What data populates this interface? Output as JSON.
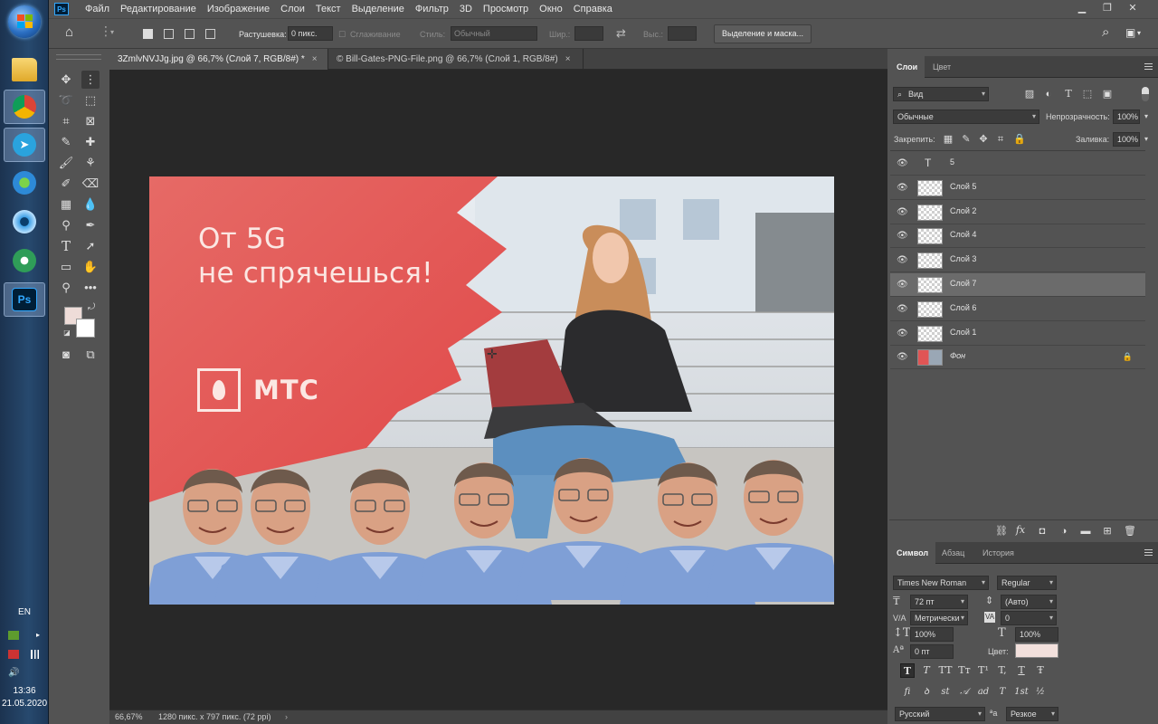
{
  "taskbar": {
    "language": "EN",
    "time": "13:36",
    "date": "21.05.2020"
  },
  "menu": {
    "app_logo": "Ps",
    "items": [
      "Файл",
      "Редактирование",
      "Изображение",
      "Слои",
      "Текст",
      "Выделение",
      "Фильтр",
      "3D",
      "Просмотр",
      "Окно",
      "Справка"
    ]
  },
  "options": {
    "feather_label": "Растушевка:",
    "feather_value": "0 пикс.",
    "antialias_label": "Сглаживание",
    "style_label": "Стиль:",
    "style_value": "Обычный",
    "width_label": "Шир.:",
    "height_label": "Выс.:",
    "select_mask_button": "Выделение и маска..."
  },
  "documents": {
    "tabs": [
      {
        "title": "3ZmlvNVJJg.jpg @ 66,7% (Слой 7, RGB/8#) *",
        "close": "×"
      },
      {
        "title": "© Bill-Gates-PNG-File.png @ 66,7% (Слой 1, RGB/8#)",
        "close": "×"
      }
    ]
  },
  "artwork": {
    "headline_line1": "От 5G",
    "headline_line2": "не спрячешься!",
    "brand": "МТС"
  },
  "status": {
    "zoom": "66,67%",
    "doc_info": "1280 пикс. x 797 пикс. (72 ppi)",
    "arrow": "›"
  },
  "layers_panel": {
    "tabs": [
      "Слои",
      "Цвет"
    ],
    "filter_value": "Вид",
    "blend_mode": "Обычные",
    "opacity_label": "Непрозрачность:",
    "opacity_value": "100%",
    "lock_label": "Закрепить:",
    "fill_label": "Заливка:",
    "fill_value": "100%",
    "layers": [
      {
        "name": "5",
        "type": "text"
      },
      {
        "name": "Слой 5",
        "type": "pixel"
      },
      {
        "name": "Слой 2",
        "type": "pixel"
      },
      {
        "name": "Слой 4",
        "type": "pixel"
      },
      {
        "name": "Слой 3",
        "type": "pixel"
      },
      {
        "name": "Слой 7",
        "type": "pixel",
        "selected": true
      },
      {
        "name": "Слой 6",
        "type": "pixel"
      },
      {
        "name": "Слой 1",
        "type": "pixel"
      },
      {
        "name": "Фон",
        "type": "background",
        "locked": true
      }
    ],
    "footer_icons": [
      "link-icon",
      "fx-icon",
      "mask-icon",
      "adjustment-icon",
      "folder-icon",
      "new-layer-icon",
      "trash-icon"
    ],
    "fx_label": "fx"
  },
  "character_panel": {
    "tabs": [
      "Символ",
      "Абзац",
      "История"
    ],
    "font_family": "Times New Roman",
    "font_style": "Regular",
    "font_size": "72 пт",
    "leading": "(Авто)",
    "kerning": "Метрически",
    "tracking": "0",
    "vertical_scale": "100%",
    "horizontal_scale": "100%",
    "baseline_shift": "0 пт",
    "color_label": "Цвет:",
    "color_value": "#f2e0dc",
    "style_buttons": [
      "T",
      "T",
      "TT",
      "Tт",
      "T¹",
      "T,",
      "T",
      "Ŧ"
    ],
    "opentype_buttons": [
      "fi",
      "ꝺ",
      "st",
      "𝒜",
      "ad",
      "T",
      "1st",
      "½"
    ],
    "language": "Русский",
    "antialias_prefix": "ªa",
    "antialias": "Резкое"
  },
  "swatches": {
    "foreground": "#eedcd8",
    "background": "#ffffff"
  }
}
